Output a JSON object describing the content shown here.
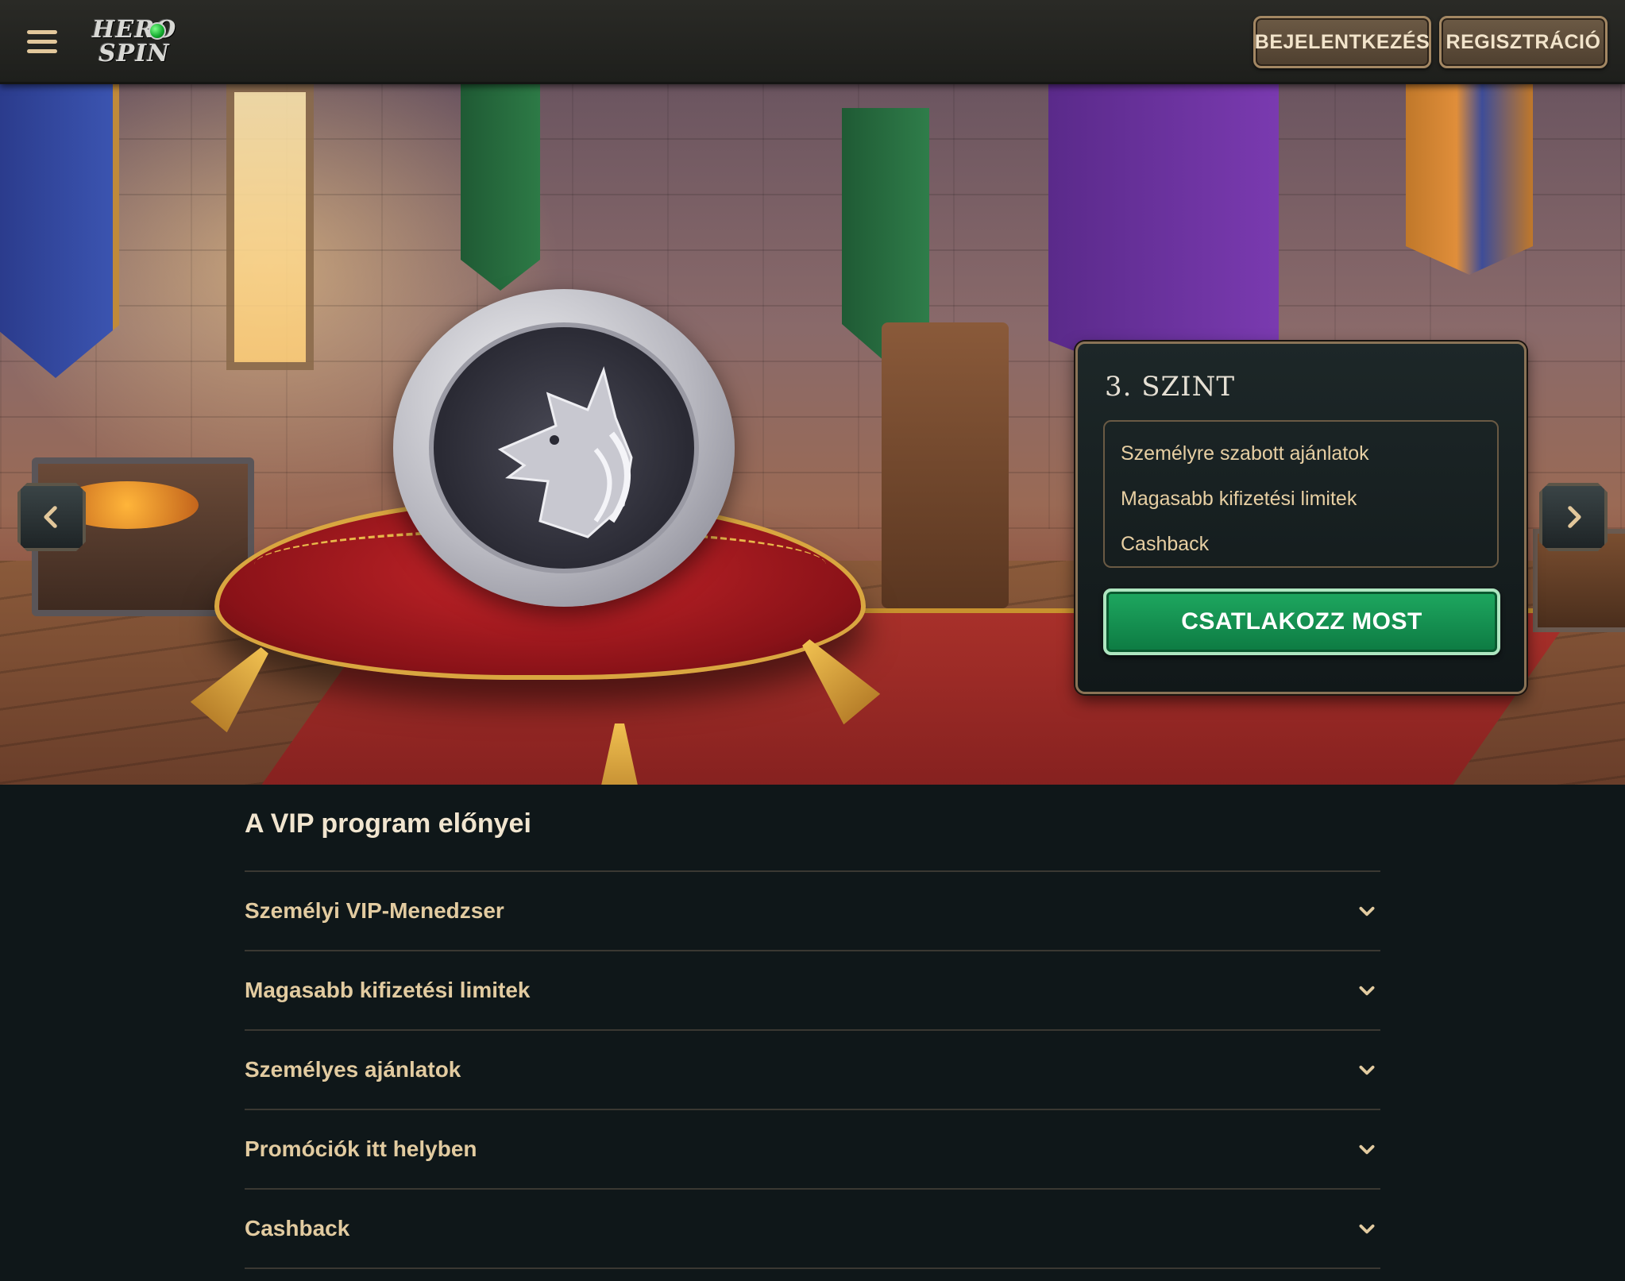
{
  "header": {
    "logo_top": "HERO",
    "logo_bottom": "SPIN",
    "login_label": "BEJELENTKEZÉS",
    "register_label": "REGISZTRÁCIÓ"
  },
  "hero": {
    "level_title": "3. SZINT",
    "level_items": [
      "Személyre szabott ajánlatok",
      "Magasabb kifizetési limitek",
      "Cashback"
    ],
    "join_label": "CSATLAKOZZ MOST"
  },
  "vip": {
    "title": "A VIP program előnyei",
    "items": [
      {
        "label": "Személyi VIP-Menedzser"
      },
      {
        "label": "Magasabb kifizetési limitek"
      },
      {
        "label": "Személyes ajánlatok"
      },
      {
        "label": "Promóciók itt helyben"
      },
      {
        "label": "Cashback"
      }
    ]
  },
  "icons": {
    "menu": "hamburger-menu-icon",
    "prev": "chevron-left-icon",
    "next": "chevron-right-icon",
    "accordion": "chevron-down-icon"
  },
  "colors": {
    "accent_gold": "#e2cba0",
    "join_green": "#1ea860",
    "background": "#0f1719"
  }
}
